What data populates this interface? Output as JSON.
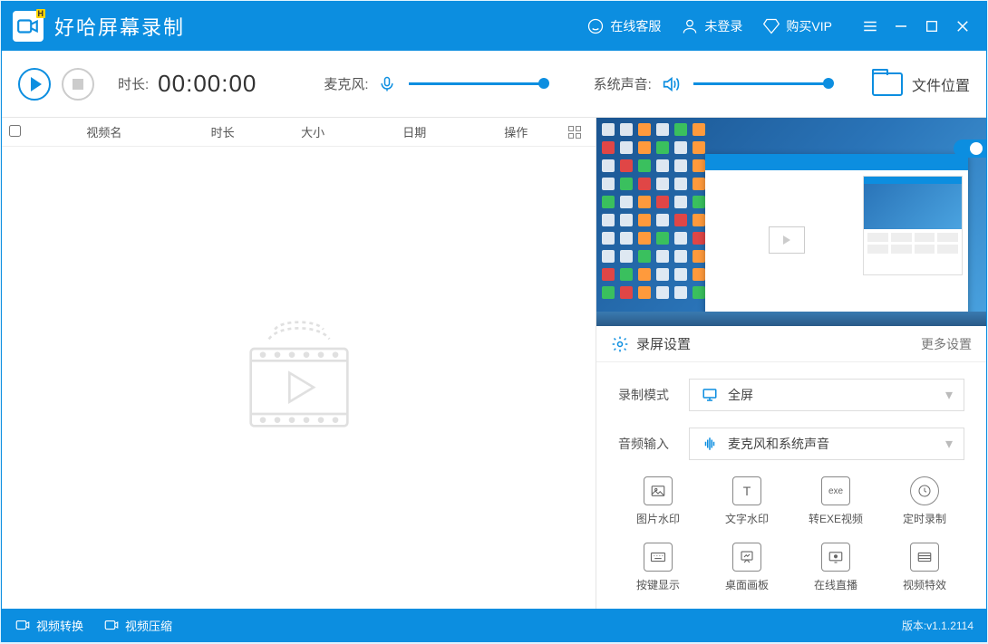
{
  "app": {
    "title": "好哈屏幕录制",
    "logo_badge": "H"
  },
  "titlebar": {
    "customer_service": "在线客服",
    "login_status": "未登录",
    "buy_vip": "购买VIP"
  },
  "toolbar": {
    "duration_label": "时长:",
    "duration_value": "00:00:00",
    "mic_label": "麦克风:",
    "speaker_label": "系统声音:",
    "folder_label": "文件位置"
  },
  "table": {
    "headers": {
      "name": "视频名",
      "duration": "时长",
      "size": "大小",
      "date": "日期",
      "operation": "操作"
    }
  },
  "settings": {
    "title": "录屏设置",
    "more": "更多设置",
    "mode_label": "录制模式",
    "mode_value": "全屏",
    "audio_label": "音频输入",
    "audio_value": "麦克风和系统声音",
    "features": [
      "图片水印",
      "文字水印",
      "转EXE视频",
      "定时录制",
      "按键显示",
      "桌面画板",
      "在线直播",
      "视频特效"
    ]
  },
  "statusbar": {
    "video_convert": "视频转换",
    "video_compress": "视频压缩",
    "version": "版本:v1.1.2114"
  }
}
